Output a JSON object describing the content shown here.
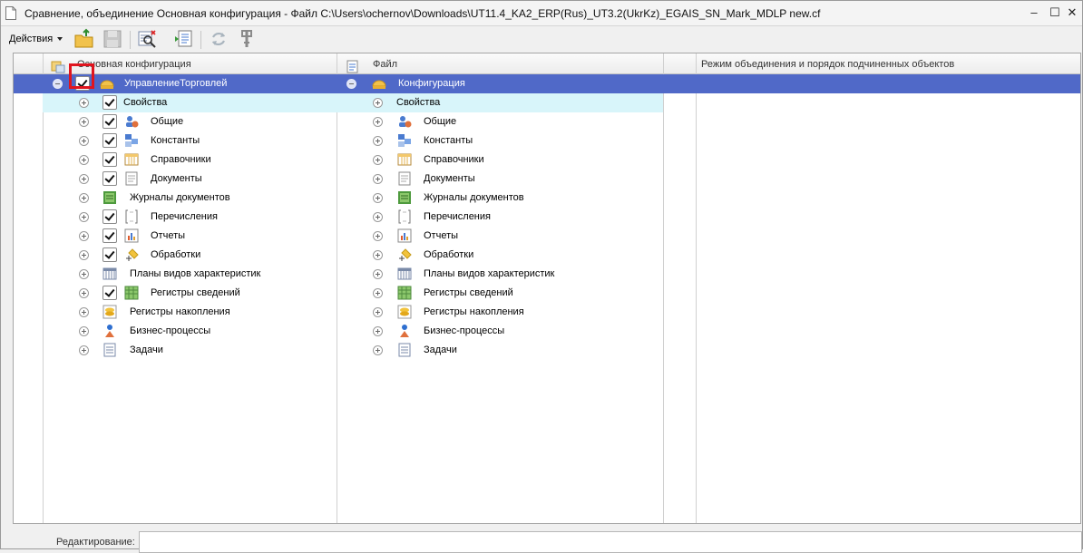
{
  "window": {
    "title": "Сравнение, объединение Основная конфигурация - Файл C:\\Users\\ochernov\\Downloads\\UT11.4_KA2_ERP(Rus)_UT3.2(UkrKz)_EGAIS_SN_Mark_MDLP new.cf",
    "minimize_glyph": "–",
    "maximize_glyph": "☐",
    "close_glyph": "✕"
  },
  "toolbar": {
    "actions_label": "Действия"
  },
  "columns": {
    "left": "Основная конфигурация",
    "middle": "Файл",
    "right": "Режим объединения и порядок подчиненных объектов"
  },
  "tree": {
    "left_root": "УправлениеТорговлей",
    "right_root": "Конфигурация",
    "items": [
      {
        "label": "Свойства",
        "icon": "properties-icon",
        "checked": true
      },
      {
        "label": "Общие",
        "icon": "common-icon",
        "checked": true
      },
      {
        "label": "Константы",
        "icon": "constants-icon",
        "checked": true
      },
      {
        "label": "Справочники",
        "icon": "catalogs-icon",
        "checked": true
      },
      {
        "label": "Документы",
        "icon": "documents-icon",
        "checked": true
      },
      {
        "label": "Журналы документов",
        "icon": "document-journals-icon",
        "checked": false
      },
      {
        "label": "Перечисления",
        "icon": "enumerations-icon",
        "checked": true
      },
      {
        "label": "Отчеты",
        "icon": "reports-icon",
        "checked": true
      },
      {
        "label": "Обработки",
        "icon": "data-processors-icon",
        "checked": true
      },
      {
        "label": "Планы видов характеристик",
        "icon": "characteristic-types-icon",
        "checked": false
      },
      {
        "label": "Регистры сведений",
        "icon": "information-registers-icon",
        "checked": true
      },
      {
        "label": "Регистры накопления",
        "icon": "accumulation-registers-icon",
        "checked": false
      },
      {
        "label": "Бизнес-процессы",
        "icon": "business-processes-icon",
        "checked": false
      },
      {
        "label": "Задачи",
        "icon": "tasks-icon",
        "checked": false
      }
    ]
  },
  "status": {
    "edit_label": "Редактирование:",
    "edit_value": ""
  },
  "colors": {
    "selection": "#5069c8",
    "highlight": "#d8f5fa",
    "annotation": "#e0141e"
  }
}
